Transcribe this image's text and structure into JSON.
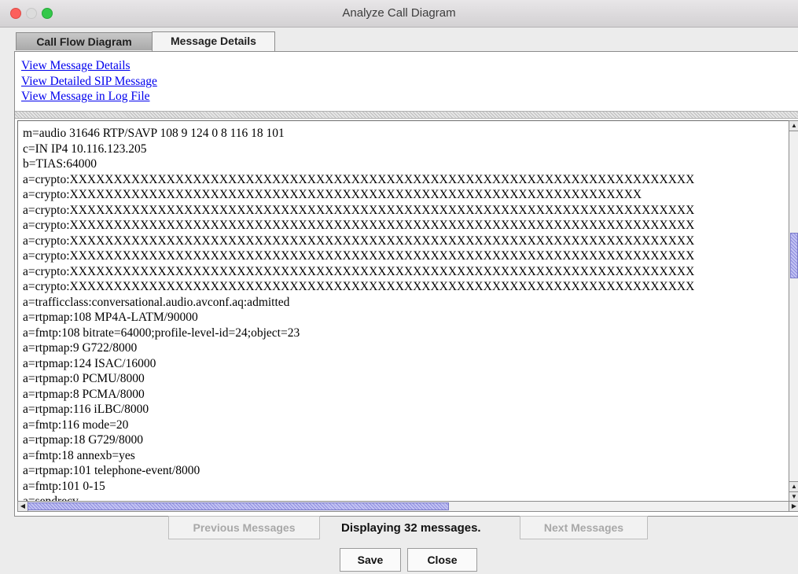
{
  "window": {
    "title": "Analyze Call Diagram"
  },
  "tabs": [
    {
      "label": "Call Flow Diagram",
      "active": false
    },
    {
      "label": "Message Details",
      "active": true
    }
  ],
  "links": [
    "View Message Details",
    "View Detailed SIP Message",
    "View Message in Log File"
  ],
  "message_lines": [
    "m=audio 31646 RTP/SAVP 108 9 124 0 8 116 18 101",
    "c=IN IP4 10.116.123.205",
    "b=TIAS:64000",
    "a=crypto:XXXXXXXXXXXXXXXXXXXXXXXXXXXXXXXXXXXXXXXXXXXXXXXXXXXXXXXXXXXXXXXXXXXXXXX",
    "a=crypto:XXXXXXXXXXXXXXXXXXXXXXXXXXXXXXXXXXXXXXXXXXXXXXXXXXXXXXXXXXXXXXXXX",
    "a=crypto:XXXXXXXXXXXXXXXXXXXXXXXXXXXXXXXXXXXXXXXXXXXXXXXXXXXXXXXXXXXXXXXXXXXXXXX",
    "a=crypto:XXXXXXXXXXXXXXXXXXXXXXXXXXXXXXXXXXXXXXXXXXXXXXXXXXXXXXXXXXXXXXXXXXXXXXX",
    "a=crypto:XXXXXXXXXXXXXXXXXXXXXXXXXXXXXXXXXXXXXXXXXXXXXXXXXXXXXXXXXXXXXXXXXXXXXXX",
    "a=crypto:XXXXXXXXXXXXXXXXXXXXXXXXXXXXXXXXXXXXXXXXXXXXXXXXXXXXXXXXXXXXXXXXXXXXXXX",
    "a=crypto:XXXXXXXXXXXXXXXXXXXXXXXXXXXXXXXXXXXXXXXXXXXXXXXXXXXXXXXXXXXXXXXXXXXXXXX",
    "a=crypto:XXXXXXXXXXXXXXXXXXXXXXXXXXXXXXXXXXXXXXXXXXXXXXXXXXXXXXXXXXXXXXXXXXXXXXX",
    "a=trafficclass:conversational.audio.avconf.aq:admitted",
    "a=rtpmap:108 MP4A-LATM/90000",
    "a=fmtp:108 bitrate=64000;profile-level-id=24;object=23",
    "a=rtpmap:9 G722/8000",
    "a=rtpmap:124 ISAC/16000",
    "a=rtpmap:0 PCMU/8000",
    "a=rtpmap:8 PCMA/8000",
    "a=rtpmap:116 iLBC/8000",
    "a=fmtp:116 mode=20",
    "a=rtpmap:18 G729/8000",
    "a=fmtp:18 annexb=yes",
    "a=rtpmap:101 telephone-event/8000",
    "a=fmtp:101 0-15",
    "a=sendrecv"
  ],
  "footer": {
    "previous_label": "Previous Messages",
    "status_text": "Displaying 32 messages.",
    "next_label": "Next Messages",
    "save_label": "Save",
    "close_label": "Close"
  },
  "icons": {
    "scroll_up": "arrow-up-icon",
    "scroll_down": "arrow-down-icon",
    "scroll_left": "arrow-left-icon",
    "scroll_right": "arrow-right-icon"
  },
  "colors": {
    "link": "#0000ee",
    "close_dot": "#fc605c",
    "max_dot": "#34c84a"
  }
}
